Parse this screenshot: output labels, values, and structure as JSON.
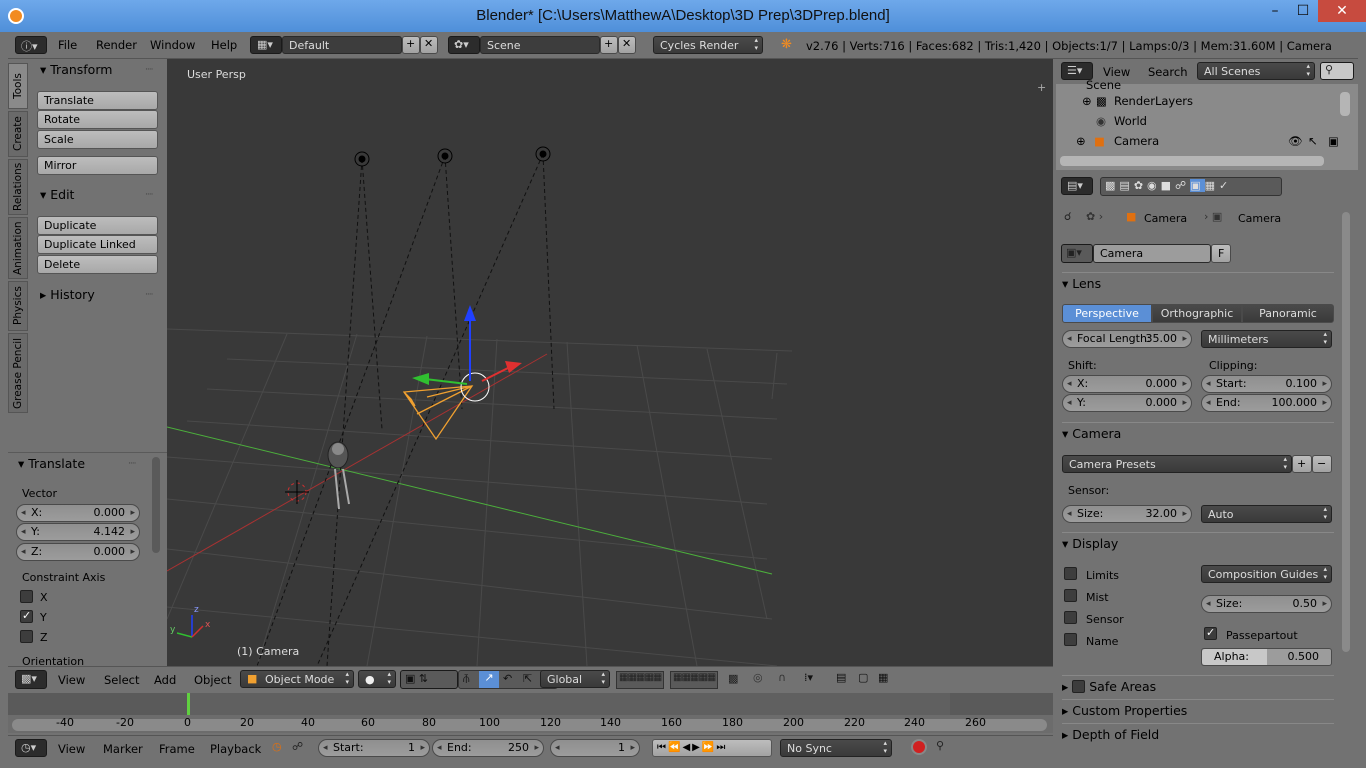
{
  "window": {
    "title": "Blender* [C:\\Users\\MatthewA\\Desktop\\3D Prep\\3DPrep.blend]",
    "minimize": "–",
    "maximize": "☐",
    "close": "✕"
  },
  "top_menu": {
    "items": [
      "File",
      "Render",
      "Window",
      "Help"
    ],
    "layout": "Default",
    "scene": "Scene",
    "engine": "Cycles Render",
    "stats": "v2.76 | Verts:716 | Faces:682 | Tris:1,420 | Objects:1/7 | Lamps:0/3 | Mem:31.60M | Camera"
  },
  "tool_tabs": [
    "Tools",
    "Create",
    "Relations",
    "Animation",
    "Physics",
    "Grease Pencil"
  ],
  "tool_panel": {
    "transform_header": "Transform",
    "transform_buttons": [
      "Translate",
      "Rotate",
      "Scale"
    ],
    "mirror": "Mirror",
    "edit_header": "Edit",
    "edit_buttons": [
      "Duplicate",
      "Duplicate Linked",
      "Delete"
    ],
    "history_header": "History"
  },
  "operator_panel": {
    "header": "Translate",
    "vector_label": "Vector",
    "x_label": "X:",
    "x_value": "0.000",
    "y_label": "Y:",
    "y_value": "4.142",
    "z_label": "Z:",
    "z_value": "0.000",
    "constraint_label": "Constraint Axis",
    "axes": [
      {
        "name": "X",
        "checked": false
      },
      {
        "name": "Y",
        "checked": true
      },
      {
        "name": "Z",
        "checked": false
      }
    ],
    "orientation_label": "Orientation"
  },
  "viewport": {
    "view_name": "User Persp",
    "object_label": "(1) Camera",
    "axis_x": "x",
    "axis_y": "y",
    "axis_z": "z",
    "colors": {
      "grid": "#4a4a4a",
      "x_axis": "#a83232",
      "y_axis": "#4caf3c",
      "camera": "#f0a030",
      "background": "#393939"
    }
  },
  "viewport_header": {
    "menus": [
      "View",
      "Select",
      "Add",
      "Object"
    ],
    "mode": "Object Mode",
    "orientation": "Global"
  },
  "timeline": {
    "ticks": [
      "-40",
      "-20",
      "0",
      "20",
      "40",
      "60",
      "80",
      "100",
      "120",
      "140",
      "160",
      "180",
      "200",
      "220",
      "240",
      "260"
    ],
    "menus": [
      "View",
      "Marker",
      "Frame",
      "Playback"
    ],
    "start_label": "Start:",
    "start_value": "1",
    "end_label": "End:",
    "end_value": "250",
    "current_frame": "1",
    "sync": "No Sync"
  },
  "outliner": {
    "menus": [
      "View",
      "Search"
    ],
    "filter": "All Scenes",
    "rows": [
      {
        "label": "Scene"
      },
      {
        "label": "RenderLayers"
      },
      {
        "label": "World"
      },
      {
        "label": "Camera"
      }
    ]
  },
  "properties": {
    "breadcrumb_object": "Camera",
    "breadcrumb_data": "Camera",
    "datablock": "Camera",
    "datablock_fake": "F",
    "lens_header": "Lens",
    "lens_types": [
      "Perspective",
      "Orthographic",
      "Panoramic"
    ],
    "focal_label": "Focal Length:",
    "focal_value": "35.00",
    "lens_unit": "Millimeters",
    "shift_label": "Shift:",
    "shift_x_label": "X:",
    "shift_x": "0.000",
    "shift_y_label": "Y:",
    "shift_y": "0.000",
    "clipping_label": "Clipping:",
    "clip_start_label": "Start:",
    "clip_start": "0.100",
    "clip_end_label": "End:",
    "clip_end": "100.000",
    "camera_header": "Camera",
    "camera_presets": "Camera Presets",
    "sensor_label": "Sensor:",
    "sensor_size_label": "Size:",
    "sensor_size": "32.00",
    "sensor_fit": "Auto",
    "display_header": "Display",
    "display_checks": [
      {
        "label": "Limits",
        "checked": false
      },
      {
        "label": "Mist",
        "checked": false
      },
      {
        "label": "Sensor",
        "checked": false
      },
      {
        "label": "Name",
        "checked": false
      }
    ],
    "composition_guides": "Composition Guides",
    "display_size_label": "Size:",
    "display_size": "0.50",
    "passepartout": "Passepartout",
    "alpha_label": "Alpha:",
    "alpha_value": "0.500",
    "safe_areas": "Safe Areas",
    "custom_props": "Custom Properties",
    "dof": "Depth of Field"
  }
}
